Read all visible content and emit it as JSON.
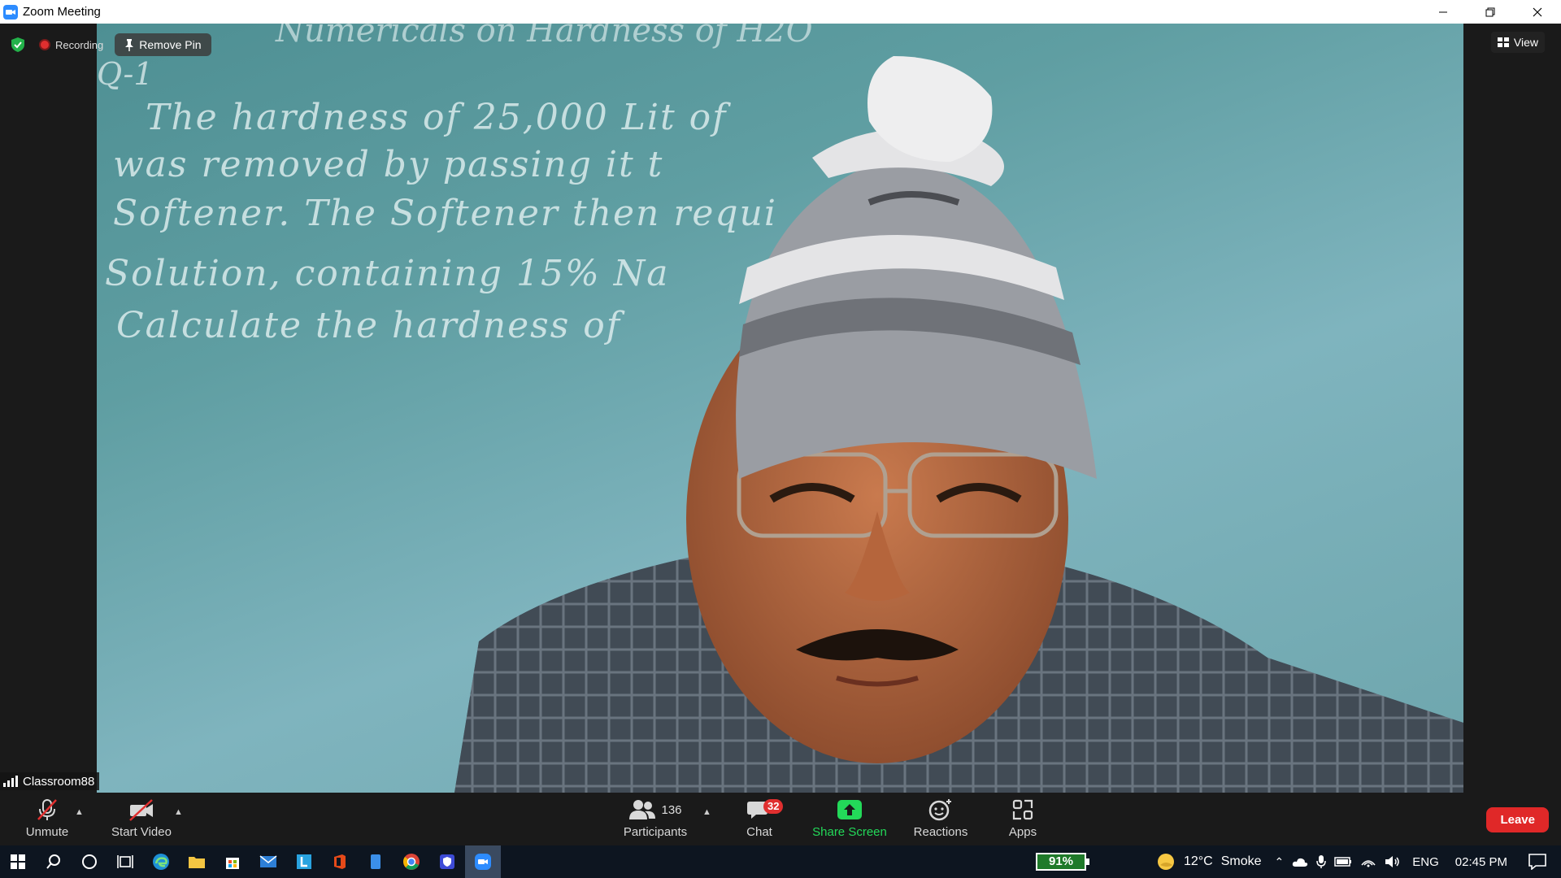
{
  "window": {
    "title": "Zoom Meeting"
  },
  "meeting": {
    "recording_label": "Recording",
    "remove_pin_label": "Remove Pin",
    "view_label": "View",
    "participant_name": "Classroom88",
    "board_lines": [
      "The hardness of 25,000 Lit of",
      "was removed by passing it t",
      "Softener. The Softener then requi",
      "Solution, containing 15% Na",
      "Calculate the hardness of"
    ],
    "board_heading": "Q-1",
    "board_topline": "Numericals on Hardness of H2O"
  },
  "toolbar": {
    "unmute_label": "Unmute",
    "start_video_label": "Start Video",
    "participants_label": "Participants",
    "participants_count": "136",
    "chat_label": "Chat",
    "chat_badge": "32",
    "share_screen_label": "Share Screen",
    "reactions_label": "Reactions",
    "apps_label": "Apps",
    "leave_label": "Leave"
  },
  "taskbar": {
    "battery_percent": "91%",
    "weather_temp": "12°C",
    "weather_desc": "Smoke",
    "language": "ENG",
    "time": "02:45 PM"
  },
  "colors": {
    "accent_zoom": "#2d8cff",
    "share_green": "#23d959",
    "leave_red": "#e02828",
    "badge_red": "#e02f2f"
  }
}
